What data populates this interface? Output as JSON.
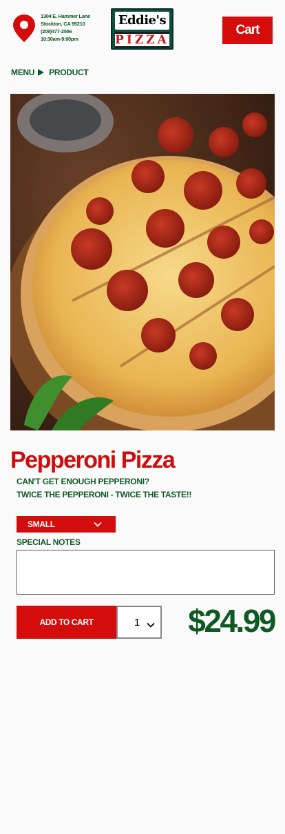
{
  "header": {
    "address": {
      "street": "1304 E. Hammer Lane",
      "city": "Stockton, CA 95210",
      "phone": "(209)477-2556",
      "hours": "10:30am-9:00pm"
    },
    "logo": {
      "line1": "Eddie's",
      "line2": "PIZZA"
    },
    "cart_label": "Cart"
  },
  "breadcrumb": {
    "menu": "MENU",
    "product": "PRODUCT"
  },
  "product": {
    "name": "Pepperoni Pizza",
    "description_line1": "CAN'T GET ENOUGH PEPPERONI?",
    "description_line2": "TWICE THE PEPPERONI - TWICE THE TASTE!!",
    "size_selected": "SMALL",
    "notes_label": "SPECIAL NOTES",
    "notes_value": "",
    "add_to_cart_label": "ADD TO CART",
    "quantity": "1",
    "price": "$24.99"
  },
  "colors": {
    "brand_red": "#d40c0c",
    "brand_green": "#0f5a24"
  }
}
